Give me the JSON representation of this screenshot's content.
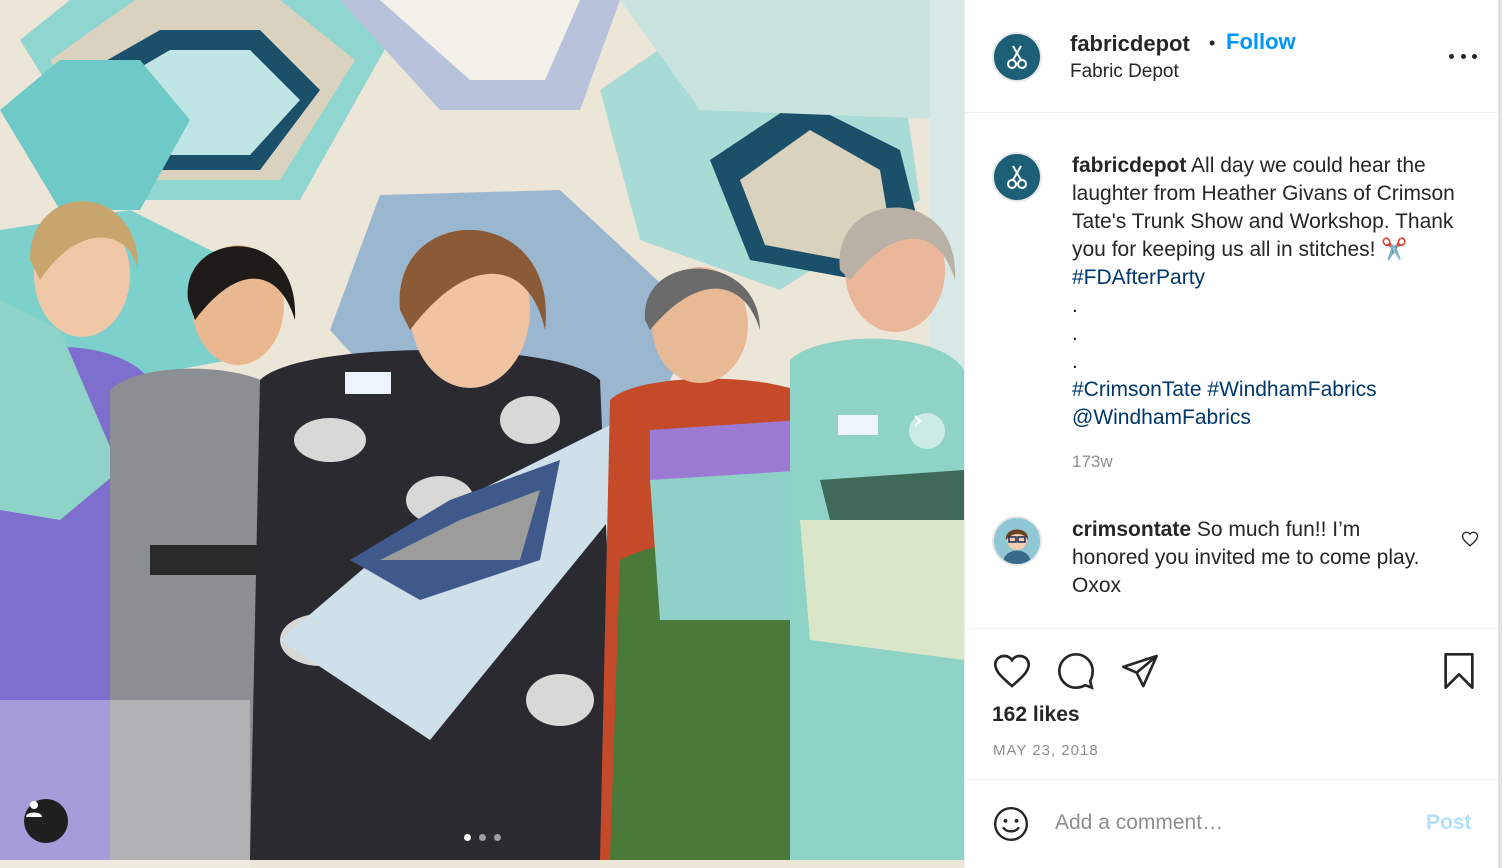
{
  "colors": {
    "accent": "#0095f6",
    "hashtag": "#00376b",
    "muted": "#8e8e8e",
    "text": "#262626",
    "post_disabled": "#b2dffc"
  },
  "photo": {
    "user_tag_icon": "person-icon",
    "next_icon": "chevron-right-icon",
    "carousel_total": 3,
    "carousel_active": 1
  },
  "header": {
    "username": "fabricdepot",
    "separator": "•",
    "follow_label": "Follow",
    "full_name": "Fabric Depot",
    "more_icon": "more-options-icon"
  },
  "caption": {
    "username": "fabricdepot",
    "body": "All day we could hear the laughter from Heather Givans of Crimson Tate's Trunk Show and Workshop. Thank you for keeping us all in stitches! ✂️",
    "hashtag_1": "#FDAfterParty",
    "dot": ".",
    "hashtag_2": "#CrimsonTate",
    "hashtag_3": "#WindhamFabrics",
    "mention": "@WindhamFabrics",
    "time": "173w"
  },
  "comment": {
    "username": "crimsontate",
    "body": "So much fun!! I’m honored you invited me to come play. Oxox"
  },
  "actions": {
    "like_icon": "heart-icon",
    "comment_icon": "comment-icon",
    "share_icon": "share-icon",
    "save_icon": "bookmark-icon",
    "likes": "162 likes",
    "date": "MAY 23, 2018"
  },
  "add_comment": {
    "emoji_icon": "emoji-icon",
    "placeholder": "Add a comment…",
    "post_label": "Post"
  }
}
